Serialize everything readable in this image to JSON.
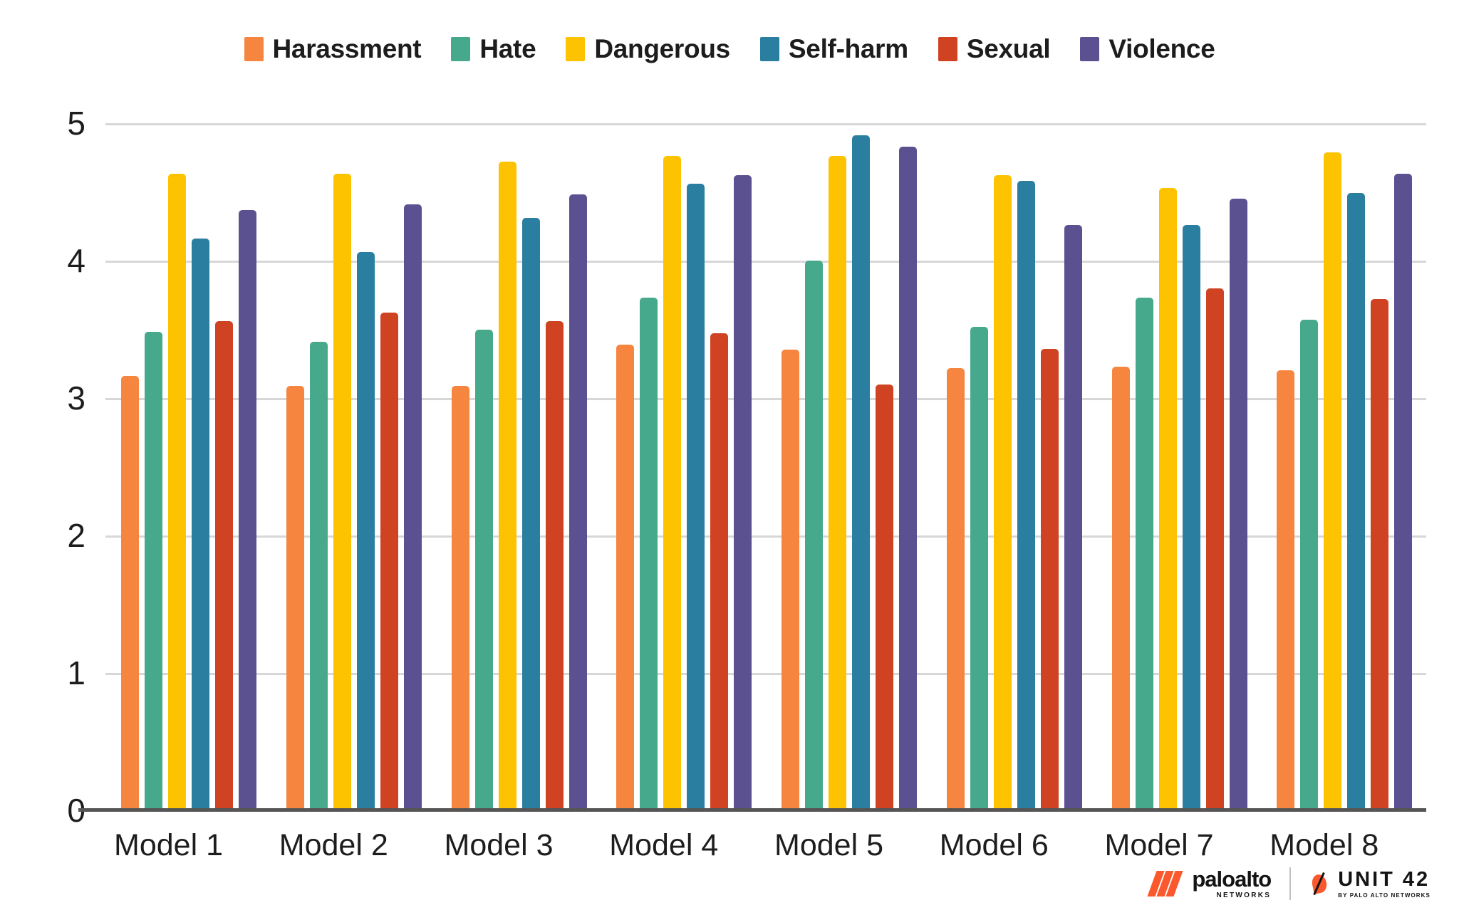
{
  "chart_data": {
    "type": "bar",
    "title": "",
    "subtitle": "",
    "xlabel": "",
    "ylabel": "",
    "ylim": [
      0,
      5
    ],
    "yticks": [
      5,
      4,
      3,
      2,
      1,
      0
    ],
    "grid": true,
    "legend_position": "top-center",
    "categories": [
      "Model 1",
      "Model 2",
      "Model 3",
      "Model 4",
      "Model 5",
      "Model 6",
      "Model 7",
      "Model 8"
    ],
    "series": [
      {
        "name": "Harassment",
        "color": "#F5853F",
        "values": [
          3.16,
          3.09,
          3.09,
          3.39,
          3.35,
          3.22,
          3.23,
          3.2
        ]
      },
      {
        "name": "Hate",
        "color": "#46A98C",
        "values": [
          3.48,
          3.41,
          3.5,
          3.73,
          4.0,
          3.52,
          3.73,
          3.57
        ]
      },
      {
        "name": "Dangerous",
        "color": "#FDC300",
        "values": [
          4.63,
          4.63,
          4.72,
          4.76,
          4.76,
          4.62,
          4.53,
          4.79
        ]
      },
      {
        "name": "Self-harm",
        "color": "#2A7FA0",
        "values": [
          4.16,
          4.06,
          4.31,
          4.56,
          4.91,
          4.58,
          4.26,
          4.49
        ]
      },
      {
        "name": "Sexual",
        "color": "#CF4222",
        "values": [
          3.56,
          3.62,
          3.56,
          3.47,
          3.1,
          3.36,
          3.8,
          3.72
        ]
      },
      {
        "name": "Violence",
        "color": "#5B5191",
        "values": [
          4.37,
          4.41,
          4.48,
          4.62,
          4.83,
          4.26,
          4.45,
          4.63
        ]
      }
    ]
  },
  "footer": {
    "paloalto_name": "paloalto",
    "paloalto_sub": "NETWORKS",
    "unit42_name": "UNIT 42",
    "unit42_sub": "BY PALO ALTO NETWORKS"
  }
}
